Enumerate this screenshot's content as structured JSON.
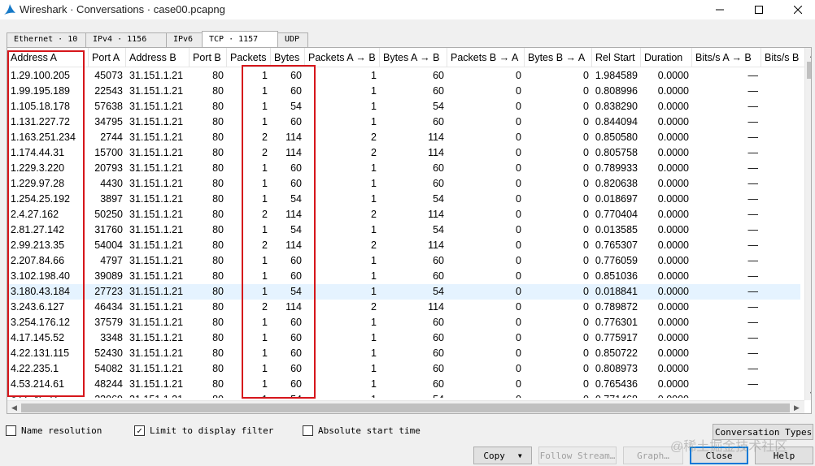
{
  "window": {
    "title": "Wireshark · Conversations · case00.pcapng",
    "minimize_icon": "minimize-icon",
    "maximize_icon": "maximize-icon",
    "close_icon": "close-icon"
  },
  "tabs": [
    {
      "label": "Ethernet · 10",
      "active": false
    },
    {
      "label": "IPv4 · 1156",
      "active": false
    },
    {
      "label": "IPv6",
      "active": false
    },
    {
      "label": "TCP · 1157",
      "active": true
    },
    {
      "label": "UDP",
      "active": false
    }
  ],
  "table": {
    "columns": [
      "Address A",
      "Port A",
      "Address B",
      "Port B",
      "Packets",
      "Bytes",
      "Packets A → B",
      "Bytes A → B",
      "Packets B → A",
      "Bytes B → A",
      "Rel Start",
      "Duration",
      "Bits/s A → B",
      "Bits/s B"
    ],
    "rows": [
      [
        "1.29.100.205",
        "45073",
        "31.151.1.21",
        "80",
        "1",
        "60",
        "1",
        "60",
        "0",
        "0",
        "1.984589",
        "0.0000",
        "—"
      ],
      [
        "1.99.195.189",
        "22543",
        "31.151.1.21",
        "80",
        "1",
        "60",
        "1",
        "60",
        "0",
        "0",
        "0.808996",
        "0.0000",
        "—"
      ],
      [
        "1.105.18.178",
        "57638",
        "31.151.1.21",
        "80",
        "1",
        "54",
        "1",
        "54",
        "0",
        "0",
        "0.838290",
        "0.0000",
        "—"
      ],
      [
        "1.131.227.72",
        "34795",
        "31.151.1.21",
        "80",
        "1",
        "60",
        "1",
        "60",
        "0",
        "0",
        "0.844094",
        "0.0000",
        "—"
      ],
      [
        "1.163.251.234",
        "2744",
        "31.151.1.21",
        "80",
        "2",
        "114",
        "2",
        "114",
        "0",
        "0",
        "0.850580",
        "0.0000",
        "—"
      ],
      [
        "1.174.44.31",
        "15700",
        "31.151.1.21",
        "80",
        "2",
        "114",
        "2",
        "114",
        "0",
        "0",
        "0.805758",
        "0.0000",
        "—"
      ],
      [
        "1.229.3.220",
        "20793",
        "31.151.1.21",
        "80",
        "1",
        "60",
        "1",
        "60",
        "0",
        "0",
        "0.789933",
        "0.0000",
        "—"
      ],
      [
        "1.229.97.28",
        "4430",
        "31.151.1.21",
        "80",
        "1",
        "60",
        "1",
        "60",
        "0",
        "0",
        "0.820638",
        "0.0000",
        "—"
      ],
      [
        "1.254.25.192",
        "3897",
        "31.151.1.21",
        "80",
        "1",
        "54",
        "1",
        "54",
        "0",
        "0",
        "0.018697",
        "0.0000",
        "—"
      ],
      [
        "2.4.27.162",
        "50250",
        "31.151.1.21",
        "80",
        "2",
        "114",
        "2",
        "114",
        "0",
        "0",
        "0.770404",
        "0.0000",
        "—"
      ],
      [
        "2.81.27.142",
        "31760",
        "31.151.1.21",
        "80",
        "1",
        "54",
        "1",
        "54",
        "0",
        "0",
        "0.013585",
        "0.0000",
        "—"
      ],
      [
        "2.99.213.35",
        "54004",
        "31.151.1.21",
        "80",
        "2",
        "114",
        "2",
        "114",
        "0",
        "0",
        "0.765307",
        "0.0000",
        "—"
      ],
      [
        "2.207.84.66",
        "4797",
        "31.151.1.21",
        "80",
        "1",
        "60",
        "1",
        "60",
        "0",
        "0",
        "0.776059",
        "0.0000",
        "—"
      ],
      [
        "3.102.198.40",
        "39089",
        "31.151.1.21",
        "80",
        "1",
        "60",
        "1",
        "60",
        "0",
        "0",
        "0.851036",
        "0.0000",
        "—"
      ],
      [
        "3.180.43.184",
        "27723",
        "31.151.1.21",
        "80",
        "1",
        "54",
        "1",
        "54",
        "0",
        "0",
        "0.018841",
        "0.0000",
        "—"
      ],
      [
        "3.243.6.127",
        "46434",
        "31.151.1.21",
        "80",
        "2",
        "114",
        "2",
        "114",
        "0",
        "0",
        "0.789872",
        "0.0000",
        "—"
      ],
      [
        "3.254.176.12",
        "37579",
        "31.151.1.21",
        "80",
        "1",
        "60",
        "1",
        "60",
        "0",
        "0",
        "0.776301",
        "0.0000",
        "—"
      ],
      [
        "4.17.145.52",
        "3348",
        "31.151.1.21",
        "80",
        "1",
        "60",
        "1",
        "60",
        "0",
        "0",
        "0.775917",
        "0.0000",
        "—"
      ],
      [
        "4.22.131.115",
        "52430",
        "31.151.1.21",
        "80",
        "1",
        "60",
        "1",
        "60",
        "0",
        "0",
        "0.850722",
        "0.0000",
        "—"
      ],
      [
        "4.22.235.1",
        "54082",
        "31.151.1.21",
        "80",
        "1",
        "60",
        "1",
        "60",
        "0",
        "0",
        "0.808973",
        "0.0000",
        "—"
      ],
      [
        "4.53.214.61",
        "48244",
        "31.151.1.21",
        "80",
        "1",
        "60",
        "1",
        "60",
        "0",
        "0",
        "0.765436",
        "0.0000",
        "—"
      ],
      [
        "4.55.46.71",
        "23069",
        "31.151.1.21",
        "80",
        "1",
        "54",
        "1",
        "54",
        "0",
        "0",
        "0.771468",
        "0.0000",
        "—"
      ]
    ],
    "selected_row": 14
  },
  "options": {
    "name_resolution": {
      "label": "Name resolution",
      "checked": false
    },
    "limit_to_display_filter": {
      "label": "Limit to display filter",
      "checked": true
    },
    "absolute_start_time": {
      "label": "Absolute start time",
      "checked": false
    }
  },
  "buttons": {
    "conversation_types": "Conversation Types",
    "copy": "Copy",
    "follow_stream": "Follow Stream…",
    "graph": "Graph…",
    "close": "Close",
    "help": "Help"
  },
  "watermark": "@稀土掘金技术社区",
  "colors": {
    "highlight_red": "#d6161b",
    "selected_row": "#e5f3ff",
    "focus_blue": "#0078d7",
    "shark_fin": "#1679c7"
  }
}
